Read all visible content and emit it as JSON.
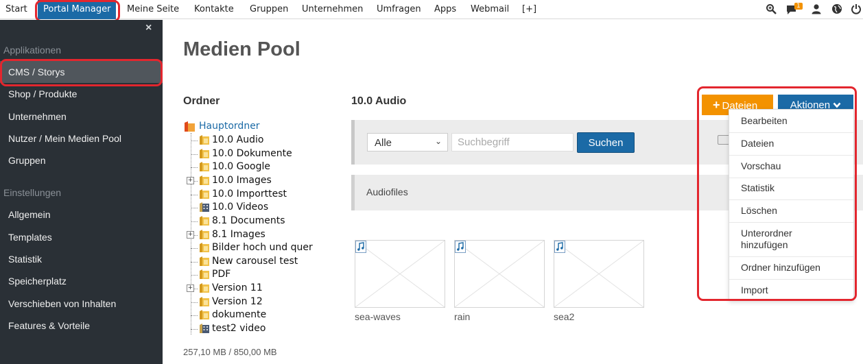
{
  "topnav": {
    "items": [
      "Start",
      "Portal Manager",
      "Meine Seite",
      "Kontakte",
      "Gruppen",
      "Unternehmen",
      "Umfragen",
      "Apps",
      "Webmail",
      "[+]"
    ],
    "notification_count": "1",
    "icons": [
      "search-icon",
      "chat-icon",
      "user-icon",
      "globe-icon",
      "power-icon"
    ]
  },
  "sidebar": {
    "close_label": "×",
    "section_apps": "Applikationen",
    "apps": [
      "CMS / Storys",
      "Shop / Produkte",
      "Unternehmen",
      "Nutzer / Mein Medien Pool",
      "Gruppen"
    ],
    "section_settings": "Einstellungen",
    "settings": [
      "Allgemein",
      "Templates",
      "Statistik",
      "Speicherplatz",
      "Verschieben von Inhalten",
      "Features & Vorteile"
    ]
  },
  "main": {
    "title": "Medien Pool",
    "folders_heading": "Ordner",
    "root_folder": "Hauptordner",
    "folders": [
      "10.0 Audio",
      "10.0 Dokumente",
      "10.0 Google",
      "10.0 Images",
      "10.0 Importtest",
      "10.0 Videos",
      "8.1 Documents",
      "8.1 Images",
      "Bilder hoch und quer",
      "New carousel test",
      "PDF",
      "Version 11",
      "Version 12",
      "dokumente",
      "test2 video"
    ],
    "quota": "257,10 MB / 850,00 MB",
    "current_folder": "10.0 Audio",
    "filter_selected": "Alle",
    "search_placeholder": "Suchbegriff",
    "search_button": "Suchen",
    "subfolder_label": "Audiofiles",
    "files": [
      "sea-waves",
      "rain",
      "sea2"
    ],
    "add_files_button": "Dateien",
    "actions_button": "Aktionen",
    "actions_menu": [
      "Bearbeiten",
      "Dateien",
      "Vorschau",
      "Statistik",
      "Löschen",
      "Unterordner hinzufügen",
      "Ordner hinzufügen",
      "Import"
    ]
  },
  "colors": {
    "nav_active": "#1b6aa6",
    "sidebar_bg": "#2a3036",
    "accent_orange": "#f39200",
    "highlight_red": "#e3262e"
  }
}
